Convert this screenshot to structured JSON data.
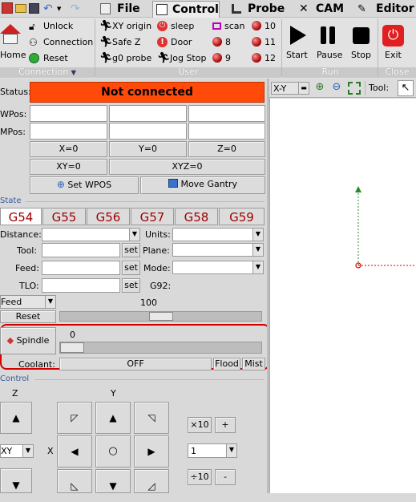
{
  "menubar": {
    "file": "File",
    "control": "Control",
    "probe": "Probe",
    "cam": "CAM",
    "editor": "Editor"
  },
  "ribbon": {
    "home": "Home",
    "unlock": "Unlock",
    "connection": "Connection",
    "reset": "Reset",
    "xy_origin": "XY origin",
    "safe_z": "Safe Z",
    "g0_probe": "g0 probe",
    "sleep": "sleep",
    "door": "Door",
    "jog_stop": "Jog Stop",
    "scan": "scan",
    "u8": "8",
    "u9": "9",
    "u10": "10",
    "u11": "11",
    "u12": "12",
    "start": "Start",
    "pause": "Pause",
    "stop": "Stop",
    "exit": "Exit",
    "grp_connection": "Connection",
    "grp_user": "User",
    "grp_run": "Run",
    "grp_close": "Close"
  },
  "status": {
    "label": "Status:",
    "value": "Not connected",
    "wpos": "WPos:",
    "mpos": "MPos:"
  },
  "zero": {
    "x0": "X=0",
    "y0": "Y=0",
    "z0": "Z=0",
    "xy0": "XY=0",
    "xyz0": "XYZ=0",
    "set_wpos": "Set WPOS",
    "move_gantry": "Move Gantry"
  },
  "state": {
    "title": "State",
    "tabs": [
      "G54",
      "G55",
      "G56",
      "G57",
      "G58",
      "G59"
    ],
    "distance": "Distance:",
    "units": "Units:",
    "tool": "Tool:",
    "plane": "Plane:",
    "feed": "Feed:",
    "mode": "Mode:",
    "tlo": "TLO:",
    "g92": "G92:",
    "set": "set"
  },
  "override": {
    "feed_select": "Feed",
    "feed_value": "100",
    "feed_percent": 100,
    "reset": "Reset",
    "spindle": "Spindle",
    "spindle_value": "0",
    "spindle_percent": 0,
    "coolant": "Coolant:",
    "coolant_state": "OFF",
    "flood": "Flood",
    "mist": "Mist"
  },
  "control": {
    "title": "Control",
    "z_label": "Z",
    "y_label": "Y",
    "x_label": "X",
    "plane_select": "XY",
    "times10": "×10",
    "plus": "+",
    "step": "1",
    "div10": "÷10",
    "minus": "-"
  },
  "canvas": {
    "view_select": "X-Y",
    "tool_label": "Tool:"
  },
  "colors": {
    "status_bg": "#ff4a0a",
    "tab_text": "#a00000",
    "highlight": "#d40000"
  }
}
